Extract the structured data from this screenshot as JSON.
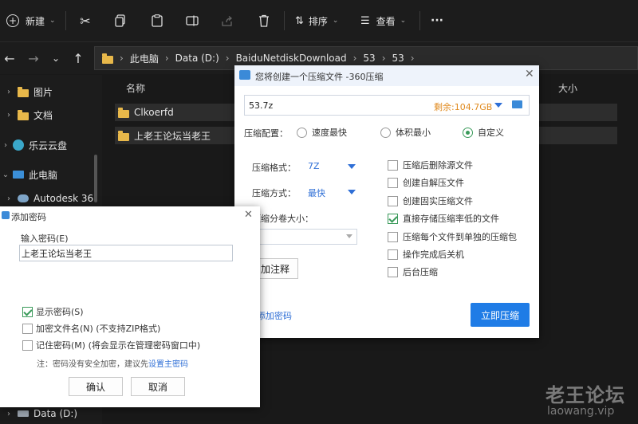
{
  "toolbar": {
    "new_label": "新建",
    "sort_label": "排序",
    "view_label": "查看",
    "more_label": "···"
  },
  "address": {
    "segments": [
      "此电脑",
      "Data (D:)",
      "BaiduNetdiskDownload",
      "53",
      "53"
    ]
  },
  "sidebar": {
    "items": [
      {
        "label": "图片"
      },
      {
        "label": "文档"
      },
      {
        "label": "乐云云盘"
      },
      {
        "label": "此电脑"
      },
      {
        "label": "Autodesk 36"
      },
      {
        "label": "Data (D:)"
      }
    ]
  },
  "files": {
    "col_name": "名称",
    "col_size": "大小",
    "rows": [
      {
        "name": "Clkoerfd"
      },
      {
        "name": "上老王论坛当老王"
      }
    ]
  },
  "compress_dialog": {
    "title": "您将创建一个压缩文件 -360压缩",
    "filename": "53.7z",
    "remaining": "剩余:104.7GB",
    "config_label": "压缩配置：",
    "radios": [
      {
        "label": "速度最快",
        "checked": false
      },
      {
        "label": "体积最小",
        "checked": false
      },
      {
        "label": "自定义",
        "checked": true
      }
    ],
    "format_label": "压缩格式：",
    "format_value": "7Z",
    "method_label": "压缩方式：",
    "method_value": "最快",
    "split_label": "压缩分卷大小：",
    "comment_button": "加注释",
    "add_password_link": "添加密码",
    "options": [
      {
        "label": "压缩后删除源文件",
        "checked": false
      },
      {
        "label": "创建自解压文件",
        "checked": false
      },
      {
        "label": "创建固实压缩文件",
        "checked": false
      },
      {
        "label": "直接存储压缩率低的文件",
        "checked": true
      },
      {
        "label": "压缩每个文件到单独的压缩包",
        "checked": false
      },
      {
        "label": "操作完成后关机",
        "checked": false
      },
      {
        "label": "后台压缩",
        "checked": false
      }
    ],
    "compress_button": "立即压缩"
  },
  "password_dialog": {
    "title": "添加密码",
    "input_label": "输入密码(E)",
    "password_value": "上老王论坛当老王",
    "checks": [
      {
        "label": "显示密码(S)",
        "checked": true
      },
      {
        "label": "加密文件名(N) (不支持ZIP格式)",
        "checked": false
      },
      {
        "label": "记住密码(M) (将会显示在管理密码窗口中)",
        "checked": false
      }
    ],
    "note": "注：密码没有安全加密，建议先",
    "note_link": "设置主密码",
    "ok_button": "确认",
    "cancel_button": "取消"
  },
  "watermark": {
    "line1": "老王论坛",
    "line2": "laowang.vip"
  },
  "colors": {
    "accent_blue": "#2f6fd6",
    "remaining_orange": "#e08a1e",
    "check_green": "#3a9a5a"
  }
}
